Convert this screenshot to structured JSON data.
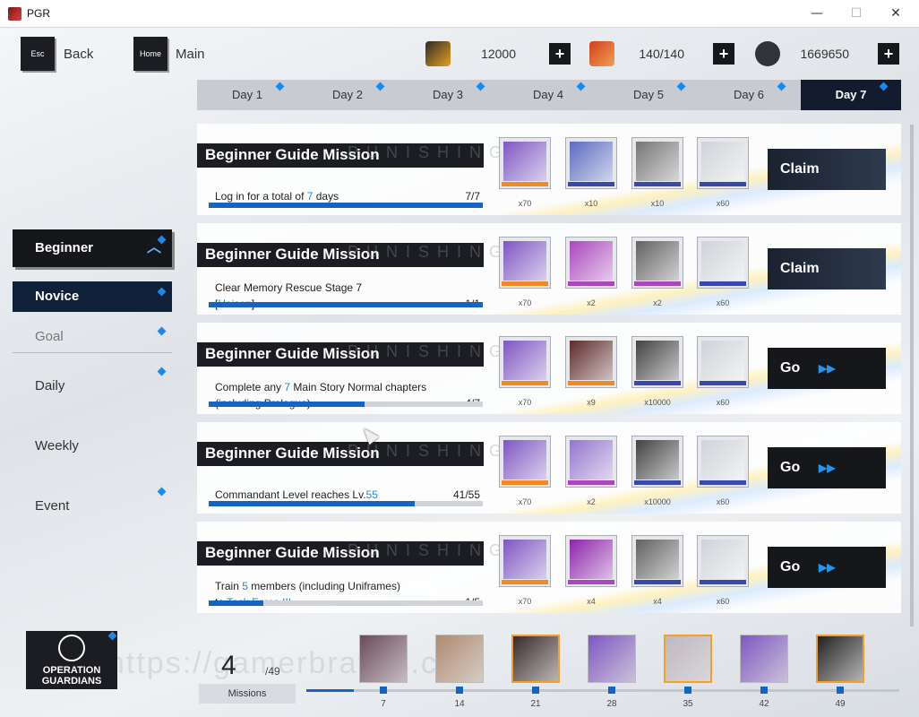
{
  "window": {
    "title": "PGR",
    "minimize": "—",
    "maximize": "☐",
    "close": "✕"
  },
  "nav": {
    "back_key": "Esc",
    "back_label": "Back",
    "home_key": "Home",
    "home_label": "Main"
  },
  "resources": [
    {
      "icon": "gold-bar-icon",
      "value": "12000",
      "color": "#e8a020"
    },
    {
      "icon": "battery-icon",
      "value": "140/140",
      "color": "#e06030"
    },
    {
      "icon": "coin-icon",
      "value": "1669650",
      "color": "#303338"
    }
  ],
  "days": [
    "Day 1",
    "Day 2",
    "Day 3",
    "Day 4",
    "Day 5",
    "Day 6",
    "Day 7"
  ],
  "active_day": "Day 7",
  "sidebar": {
    "beginner": "Beginner",
    "novice": "Novice",
    "goal": "Goal",
    "daily": "Daily",
    "weekly": "Weekly",
    "event": "Event"
  },
  "mission_ghost": "PUNISHING",
  "missions": [
    {
      "title": "Beginner Guide Mission",
      "desc1_pre": "Log in for a total of ",
      "desc1_hl": "7",
      "desc1_post": " days",
      "desc2_pre": "",
      "desc2_hl": "",
      "desc2_post": "",
      "count": "7/7",
      "progress": 1.0,
      "button": "Claim",
      "rewards": [
        {
          "qty": "x70",
          "color": "#7e57c2",
          "band": "#f08a24"
        },
        {
          "qty": "x10",
          "color": "#5c6bc0",
          "band": "#3949ab"
        },
        {
          "qty": "x10",
          "color": "#757575",
          "band": "#3949ab"
        },
        {
          "qty": "x60",
          "color": "#cfd3d8",
          "band": "#3949ab"
        }
      ]
    },
    {
      "title": "Beginner Guide Mission",
      "desc1_pre": "Clear Memory Rescue Stage 7",
      "desc1_hl": "",
      "desc1_post": "",
      "desc2_pre": "[",
      "desc2_hl": "Heisen",
      "desc2_post": "]",
      "count": "1/1",
      "progress": 1.0,
      "button": "Claim",
      "rewards": [
        {
          "qty": "x70",
          "color": "#7e57c2",
          "band": "#f08a24"
        },
        {
          "qty": "x2",
          "color": "#ab47bc",
          "band": "#ab47bc"
        },
        {
          "qty": "x2",
          "color": "#616161",
          "band": "#ab47bc"
        },
        {
          "qty": "x60",
          "color": "#cfd3d8",
          "band": "#3949ab"
        }
      ]
    },
    {
      "title": "Beginner Guide Mission",
      "desc1_pre": "Complete any ",
      "desc1_hl": "7",
      "desc1_post": " Main Story Normal chapters",
      "desc2_pre": "(including Prologue)",
      "desc2_hl": "",
      "desc2_post": "",
      "count": "4/7",
      "progress": 0.571,
      "button": "Go",
      "rewards": [
        {
          "qty": "x70",
          "color": "#7e57c2",
          "band": "#f08a24"
        },
        {
          "qty": "x9",
          "color": "#5d2b2b",
          "band": "#f08a24"
        },
        {
          "qty": "x10000",
          "color": "#424242",
          "band": "#3949ab"
        },
        {
          "qty": "x60",
          "color": "#cfd3d8",
          "band": "#3949ab"
        }
      ]
    },
    {
      "title": "Beginner Guide Mission",
      "desc1_pre": "Commandant Level reaches Lv.",
      "desc1_hl": "55",
      "desc1_post": "",
      "desc2_pre": "",
      "desc2_hl": "",
      "desc2_post": "",
      "count": "41/55",
      "progress": 0.745,
      "button": "Go",
      "rewards": [
        {
          "qty": "x70",
          "color": "#7e57c2",
          "band": "#f08a24"
        },
        {
          "qty": "x2",
          "color": "#9575cd",
          "band": "#ab47bc"
        },
        {
          "qty": "x10000",
          "color": "#424242",
          "band": "#3949ab"
        },
        {
          "qty": "x60",
          "color": "#cfd3d8",
          "band": "#3949ab"
        }
      ]
    },
    {
      "title": "Beginner Guide Mission",
      "desc1_pre": "Train ",
      "desc1_hl": "5",
      "desc1_post": " members (including Uniframes)",
      "desc2_pre": "to ",
      "desc2_hl": "Task Force III",
      "desc2_post": "",
      "count": "1/5",
      "progress": 0.2,
      "button": "Go",
      "rewards": [
        {
          "qty": "x70",
          "color": "#7e57c2",
          "band": "#f08a24"
        },
        {
          "qty": "x4",
          "color": "#8e24aa",
          "band": "#ab47bc"
        },
        {
          "qty": "x4",
          "color": "#616161",
          "band": "#3949ab"
        },
        {
          "qty": "x60",
          "color": "#cfd3d8",
          "band": "#3949ab"
        }
      ]
    }
  ],
  "bottom": {
    "logo_line1": "OPERATION",
    "logo_line2": "GUARDIANS",
    "completed": "4",
    "total": "/49",
    "missions_label": "Missions",
    "progress": 0.08,
    "watermark": "https://gamerbraves.com",
    "milestones": [
      {
        "label": "7",
        "color": "#6a4a5a",
        "gold": false
      },
      {
        "label": "14",
        "color": "#b08a70",
        "gold": false
      },
      {
        "label": "21",
        "color": "#3a2a2a",
        "gold": true
      },
      {
        "label": "28",
        "color": "#7e57c2",
        "gold": false
      },
      {
        "label": "35",
        "color": "#c0b8c0",
        "gold": true
      },
      {
        "label": "42",
        "color": "#7e57c2",
        "gold": false
      },
      {
        "label": "49",
        "color": "#222",
        "gold": true
      }
    ]
  }
}
